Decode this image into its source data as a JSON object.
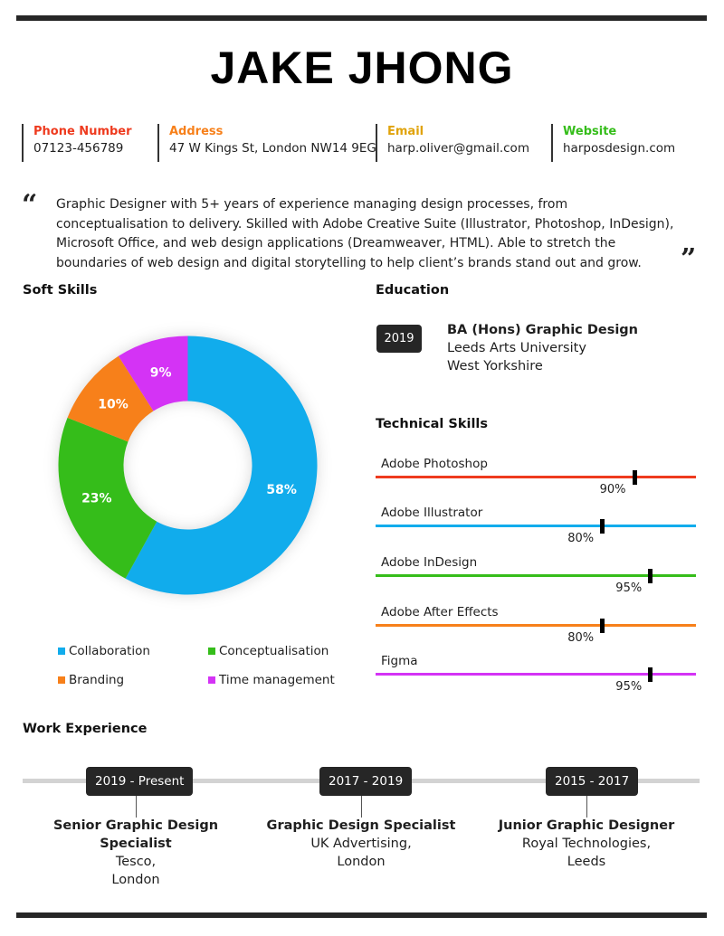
{
  "name": "JAKE JHONG",
  "contacts": [
    {
      "label": "Phone Number",
      "value": "07123-456789",
      "color": "#ee3a1e"
    },
    {
      "label": "Address",
      "value": "47 W Kings St, London NW14 9EG",
      "color": "#f7801a"
    },
    {
      "label": "Email",
      "value": "harp.oliver@gmail.com",
      "color": "#e0a30c"
    },
    {
      "label": "Website",
      "value": "harposdesign.com",
      "color": "#35bd1a"
    }
  ],
  "summary": {
    "open_quote": "“",
    "close_quote": "”",
    "text": "Graphic Designer with 5+ years of experience managing design processes, from conceptualisation to delivery. Skilled with Adobe Creative Suite (Illustrator, Photoshop, InDesign), Microsoft Office, and web design applications (Dreamweaver, HTML). Able to stretch the boundaries of web design and digital storytelling to help client’s brands stand out and grow."
  },
  "sections": {
    "soft_skills": "Soft Skills",
    "education": "Education",
    "technical_skills": "Technical Skills",
    "work_experience": "Work Experience"
  },
  "chart_data": {
    "type": "pie",
    "title": "Soft Skills",
    "categories": [
      "Collaboration",
      "Conceptualisation",
      "Branding",
      "Time management"
    ],
    "values": [
      58,
      23,
      10,
      9
    ],
    "labels": [
      "58%",
      "23%",
      "10%",
      "9%"
    ],
    "colors": [
      "#11acec",
      "#35bd1a",
      "#f7801a",
      "#d433f5"
    ],
    "donut": true,
    "legend_position": "bottom"
  },
  "legend": [
    {
      "label": "Collaboration",
      "color": "#11acec"
    },
    {
      "label": "Conceptualisation",
      "color": "#35bd1a"
    },
    {
      "label": "Branding",
      "color": "#f7801a"
    },
    {
      "label": "Time management",
      "color": "#d433f5"
    }
  ],
  "education": {
    "year": "2019",
    "degree": "BA (Hons) Graphic Design",
    "school": "Leeds Arts University",
    "location": "West Yorkshire"
  },
  "technical_skills": [
    {
      "name": "Adobe Photoshop",
      "percent": 90,
      "label": "90%",
      "color": "#ee3a1e"
    },
    {
      "name": "Adobe Illustrator",
      "percent": 80,
      "label": "80%",
      "color": "#11acec"
    },
    {
      "name": "Adobe InDesign",
      "percent": 95,
      "label": "95%",
      "color": "#35bd1a"
    },
    {
      "name": "Adobe After Effects",
      "percent": 80,
      "label": "80%",
      "color": "#f7801a"
    },
    {
      "name": "Figma",
      "percent": 95,
      "label": "95%",
      "color": "#d433f5"
    }
  ],
  "work_experience": [
    {
      "dates": "2019 - Present",
      "title": "Senior Graphic Design Specialist",
      "company": "Tesco,",
      "city": "London"
    },
    {
      "dates": "2017 - 2019",
      "title": "Graphic Design Specialist",
      "company": "UK Advertising,",
      "city": "London"
    },
    {
      "dates": "2015 - 2017",
      "title": "Junior Graphic Designer",
      "company": "Royal Technologies,",
      "city": "Leeds"
    }
  ]
}
